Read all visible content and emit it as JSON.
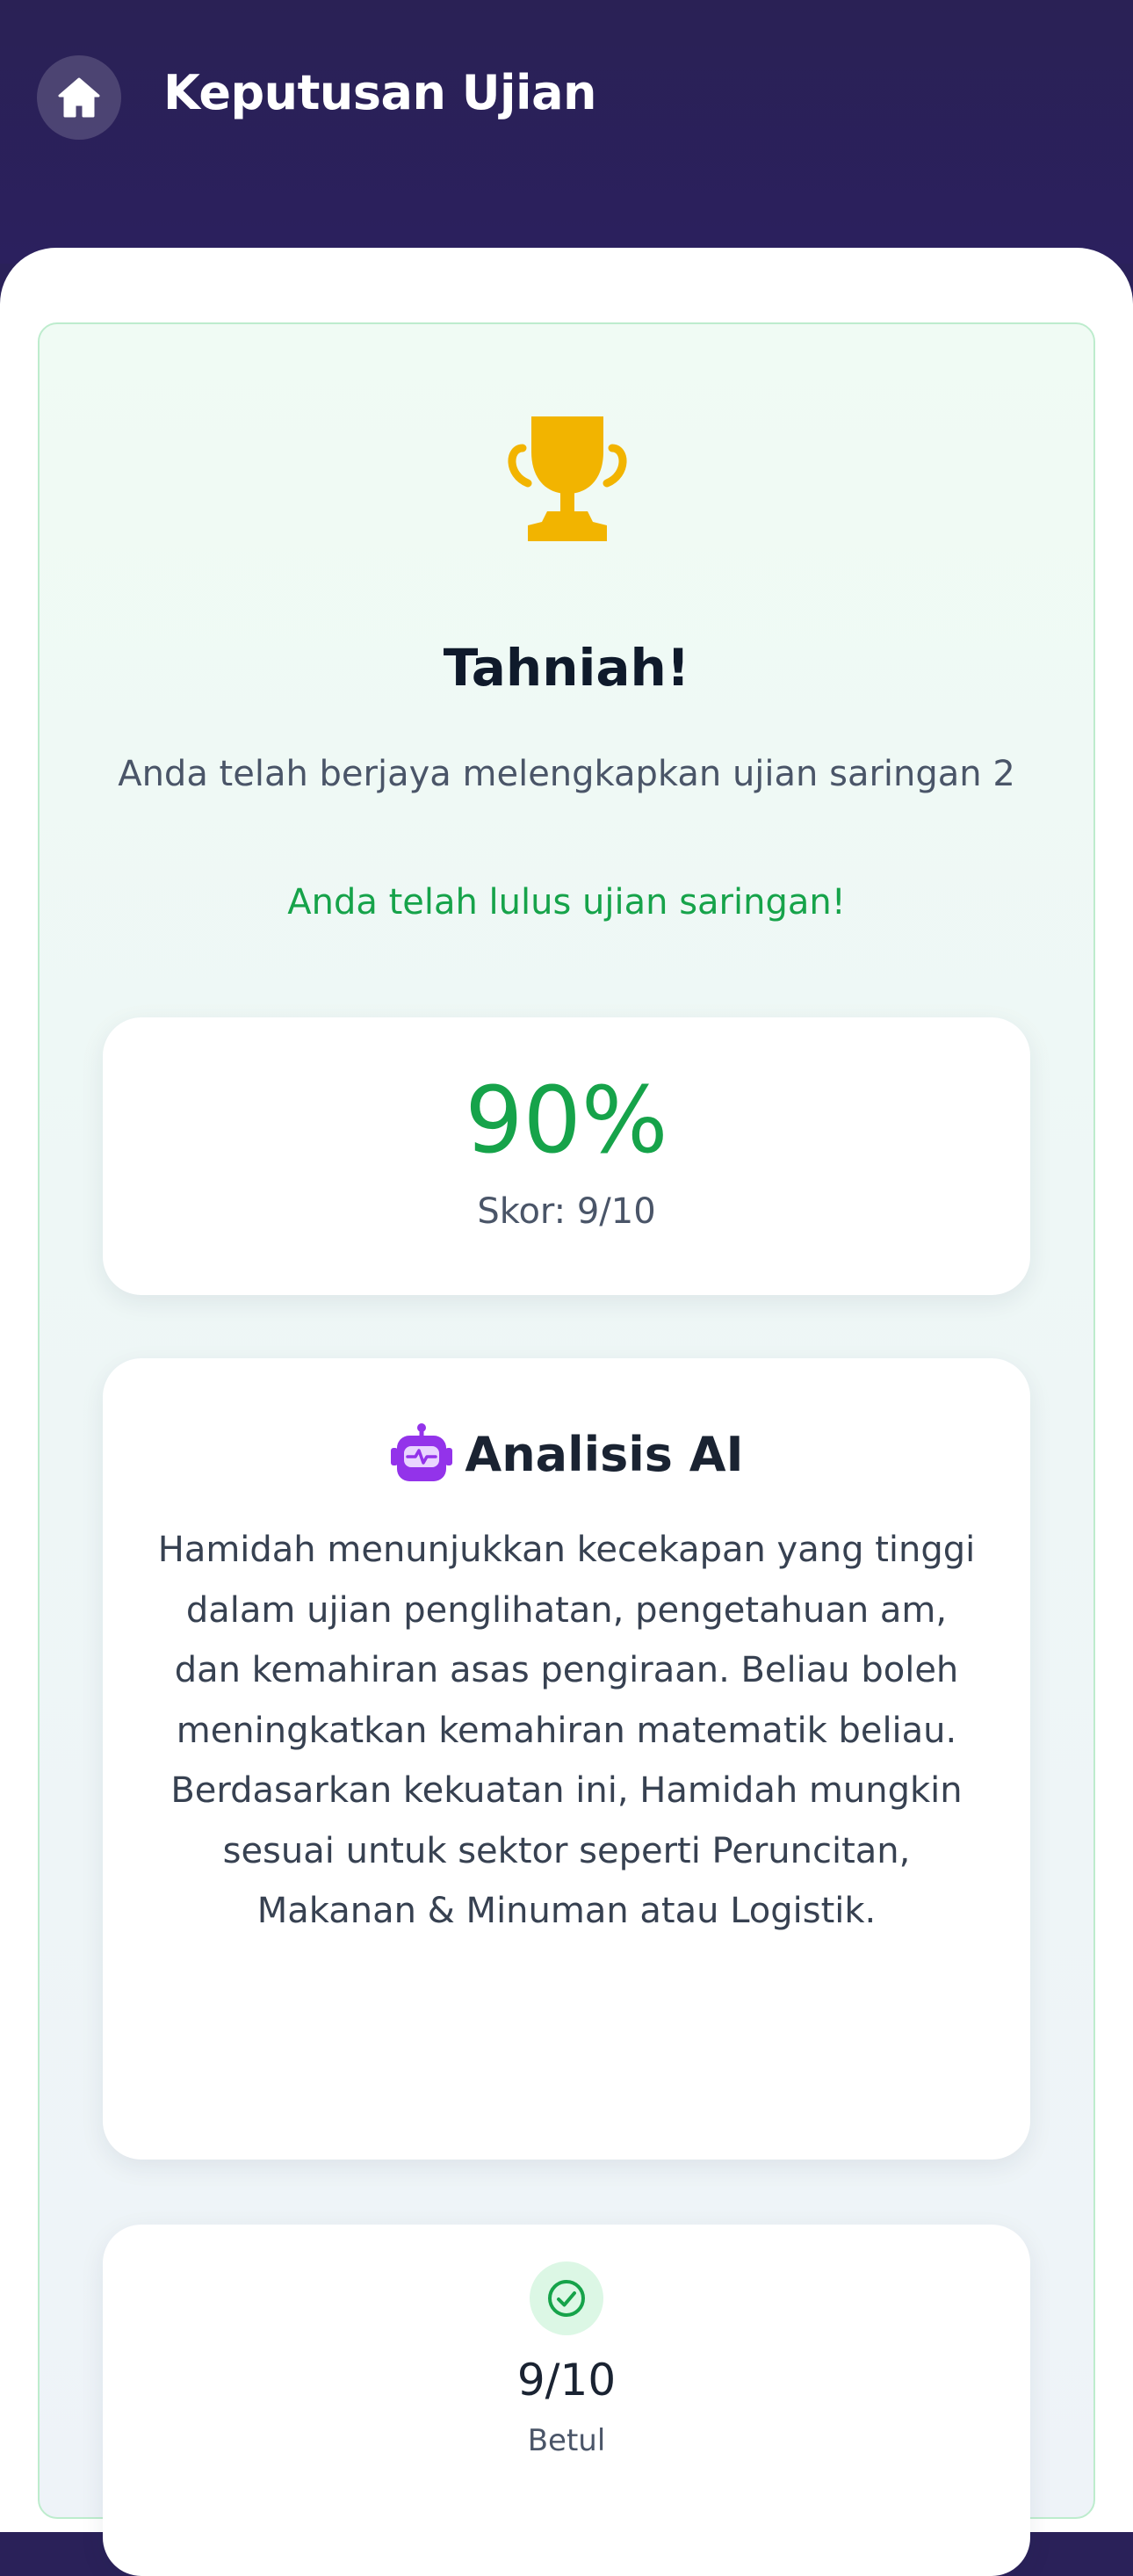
{
  "header": {
    "title": "Keputusan Ujian",
    "home_icon": "home-icon"
  },
  "result": {
    "trophy_icon": "trophy-icon",
    "trophy_color": "#f2b400",
    "title": "Tahniah!",
    "subtitle": "Anda telah berjaya melengkapkan ujian saringan 2",
    "pass_message": "Anda telah lulus ujian saringan!",
    "pass_color": "#16a34a"
  },
  "score_card": {
    "percent": "90%",
    "score_text": "Skor: 9/10"
  },
  "ai_card": {
    "icon": "robot-icon",
    "icon_color": "#9333ea",
    "title": "Analisis AI",
    "text": "Hamidah menunjukkan kecekapan yang tinggi dalam ujian penglihatan, pengetahuan am, dan kemahiran asas pengiraan. Beliau boleh meningkatkan kemahiran matematik beliau. Berdasarkan kekuatan ini, Hamidah mungkin sesuai untuk sektor seperti Peruncitan, Makanan & Minuman atau Logistik."
  },
  "stat_card": {
    "icon": "check-circle-icon",
    "value": "9/10",
    "label": "Betul"
  }
}
